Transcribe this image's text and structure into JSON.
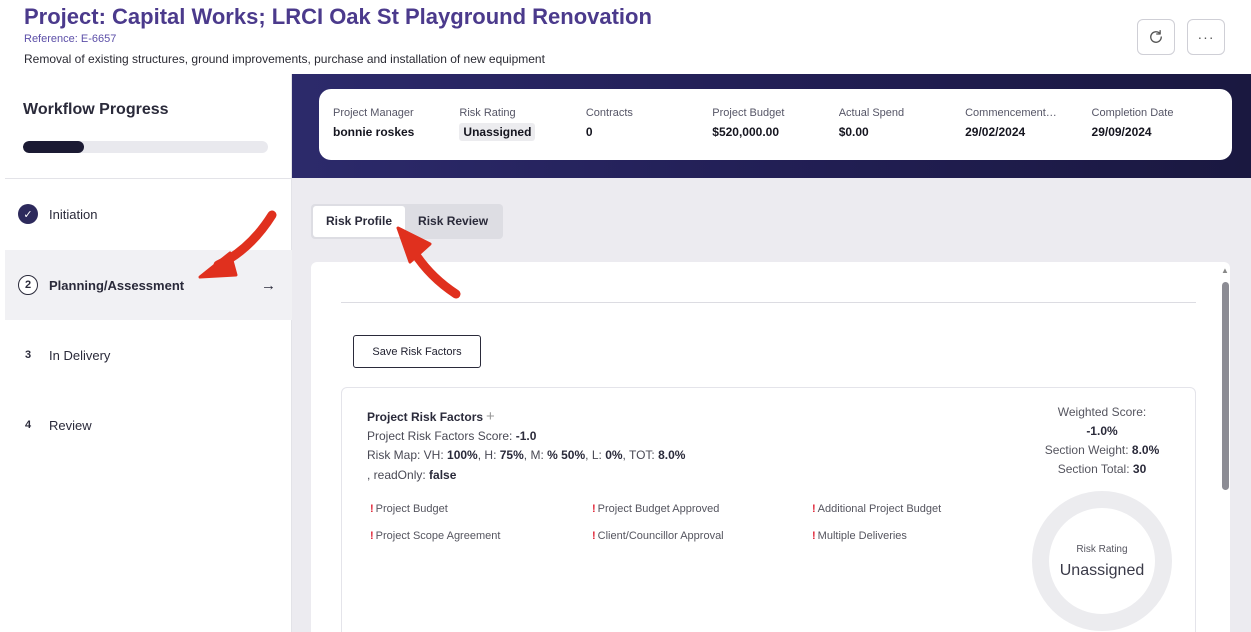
{
  "header": {
    "title": "Project: Capital Works; LRCI Oak St Playground Renovation",
    "reference": "Reference: E-6657",
    "description": "Removal of existing structures, ground improvements, purchase and installation of new equipment",
    "refresh_icon": "refresh-icon",
    "more_icon": "more-horizontal-icon",
    "more_label": "···"
  },
  "workflow": {
    "title": "Workflow Progress",
    "progress": 0.25,
    "steps": [
      {
        "number": "",
        "label": "Initiation",
        "state": "done",
        "icon": "check-circle-icon",
        "icon_glyph": "✓"
      },
      {
        "number": "2",
        "label": "Planning/Assessment",
        "state": "active",
        "arrow": "→"
      },
      {
        "number": "3",
        "label": "In Delivery",
        "state": "pending"
      },
      {
        "number": "4",
        "label": "Review",
        "state": "pending"
      }
    ]
  },
  "stats": [
    {
      "label": "Project Manager",
      "value": "bonnie roskes"
    },
    {
      "label": "Risk Rating",
      "value": "Unassigned"
    },
    {
      "label": "Contracts",
      "value": "0"
    },
    {
      "label": "Project Budget",
      "value": "$520,000.00"
    },
    {
      "label": "Actual Spend",
      "value": "$0.00"
    },
    {
      "label": "Commencement…",
      "value": "29/02/2024"
    },
    {
      "label": "Completion Date",
      "value": "29/09/2024"
    }
  ],
  "tabs": [
    {
      "label": "Risk Profile",
      "active": true
    },
    {
      "label": "Risk Review",
      "active": false
    }
  ],
  "content": {
    "save_button": "Save Risk Factors",
    "risk": {
      "title": "Project Risk Factors",
      "plus": "+",
      "score_label": "Project Risk Factors Score:",
      "score_value": "-1.0",
      "map_prefix": "Risk Map: VH:",
      "vh": "100%",
      "h_label": ", H:",
      "h": "75%",
      "m_label": ", M:",
      "m": "% 50%",
      "l_label": ", L:",
      "l": "0%",
      "tot_label": ", TOT:",
      "tot": "8.0%",
      "readonly_label": ", readOnly:",
      "readonly": "false",
      "factors": [
        "Project Budget",
        "Project Budget Approved",
        "Additional Project Budget",
        "Project Scope Agreement",
        "Client/Councillor Approval",
        "Multiple Deliveries"
      ],
      "weighted_label": "Weighted Score:",
      "weighted_value": "-1.0%",
      "section_weight_label": "Section Weight:",
      "section_weight_value": "8.0%",
      "section_total_label": "Section Total:",
      "section_total_value": "30",
      "rating_label": "Risk Rating",
      "rating_value": "Unassigned"
    }
  },
  "colors": {
    "title": "#4b3a8c",
    "banner": "#2c2a6b",
    "annotation": "#e0301e",
    "warning": "#e0283a"
  }
}
